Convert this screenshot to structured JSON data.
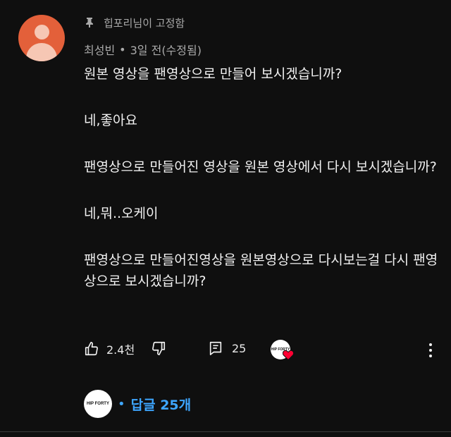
{
  "comment": {
    "pinned_label": "힙포리님이 고정함",
    "author": "최성빈",
    "meta_separator": "•",
    "time": "3일 전(수정됨)",
    "paragraphs": [
      "원본 영상을 팬영상으로 만들어 보시겠습니까?",
      "네,좋아요",
      "팬영상으로 만들어진 영상을 원본 영상에서 다시 보시겠습니까?",
      "네,뭐..오케이",
      "팬영상으로 만들어진영상을 원본영상으로 다시보는걸 다시 팬영상으로 보시겠습니까?"
    ],
    "avatar_color": "#e3603a"
  },
  "actions": {
    "like_count": "2.4천",
    "reply_count": "25",
    "creator_logo_text": "HIP FORTY",
    "heart_color": "#ff0033"
  },
  "replies": {
    "logo_text": "HIP FORTY",
    "separator": "•",
    "label": "답글 25개",
    "accent_color": "#3ea6ff"
  }
}
